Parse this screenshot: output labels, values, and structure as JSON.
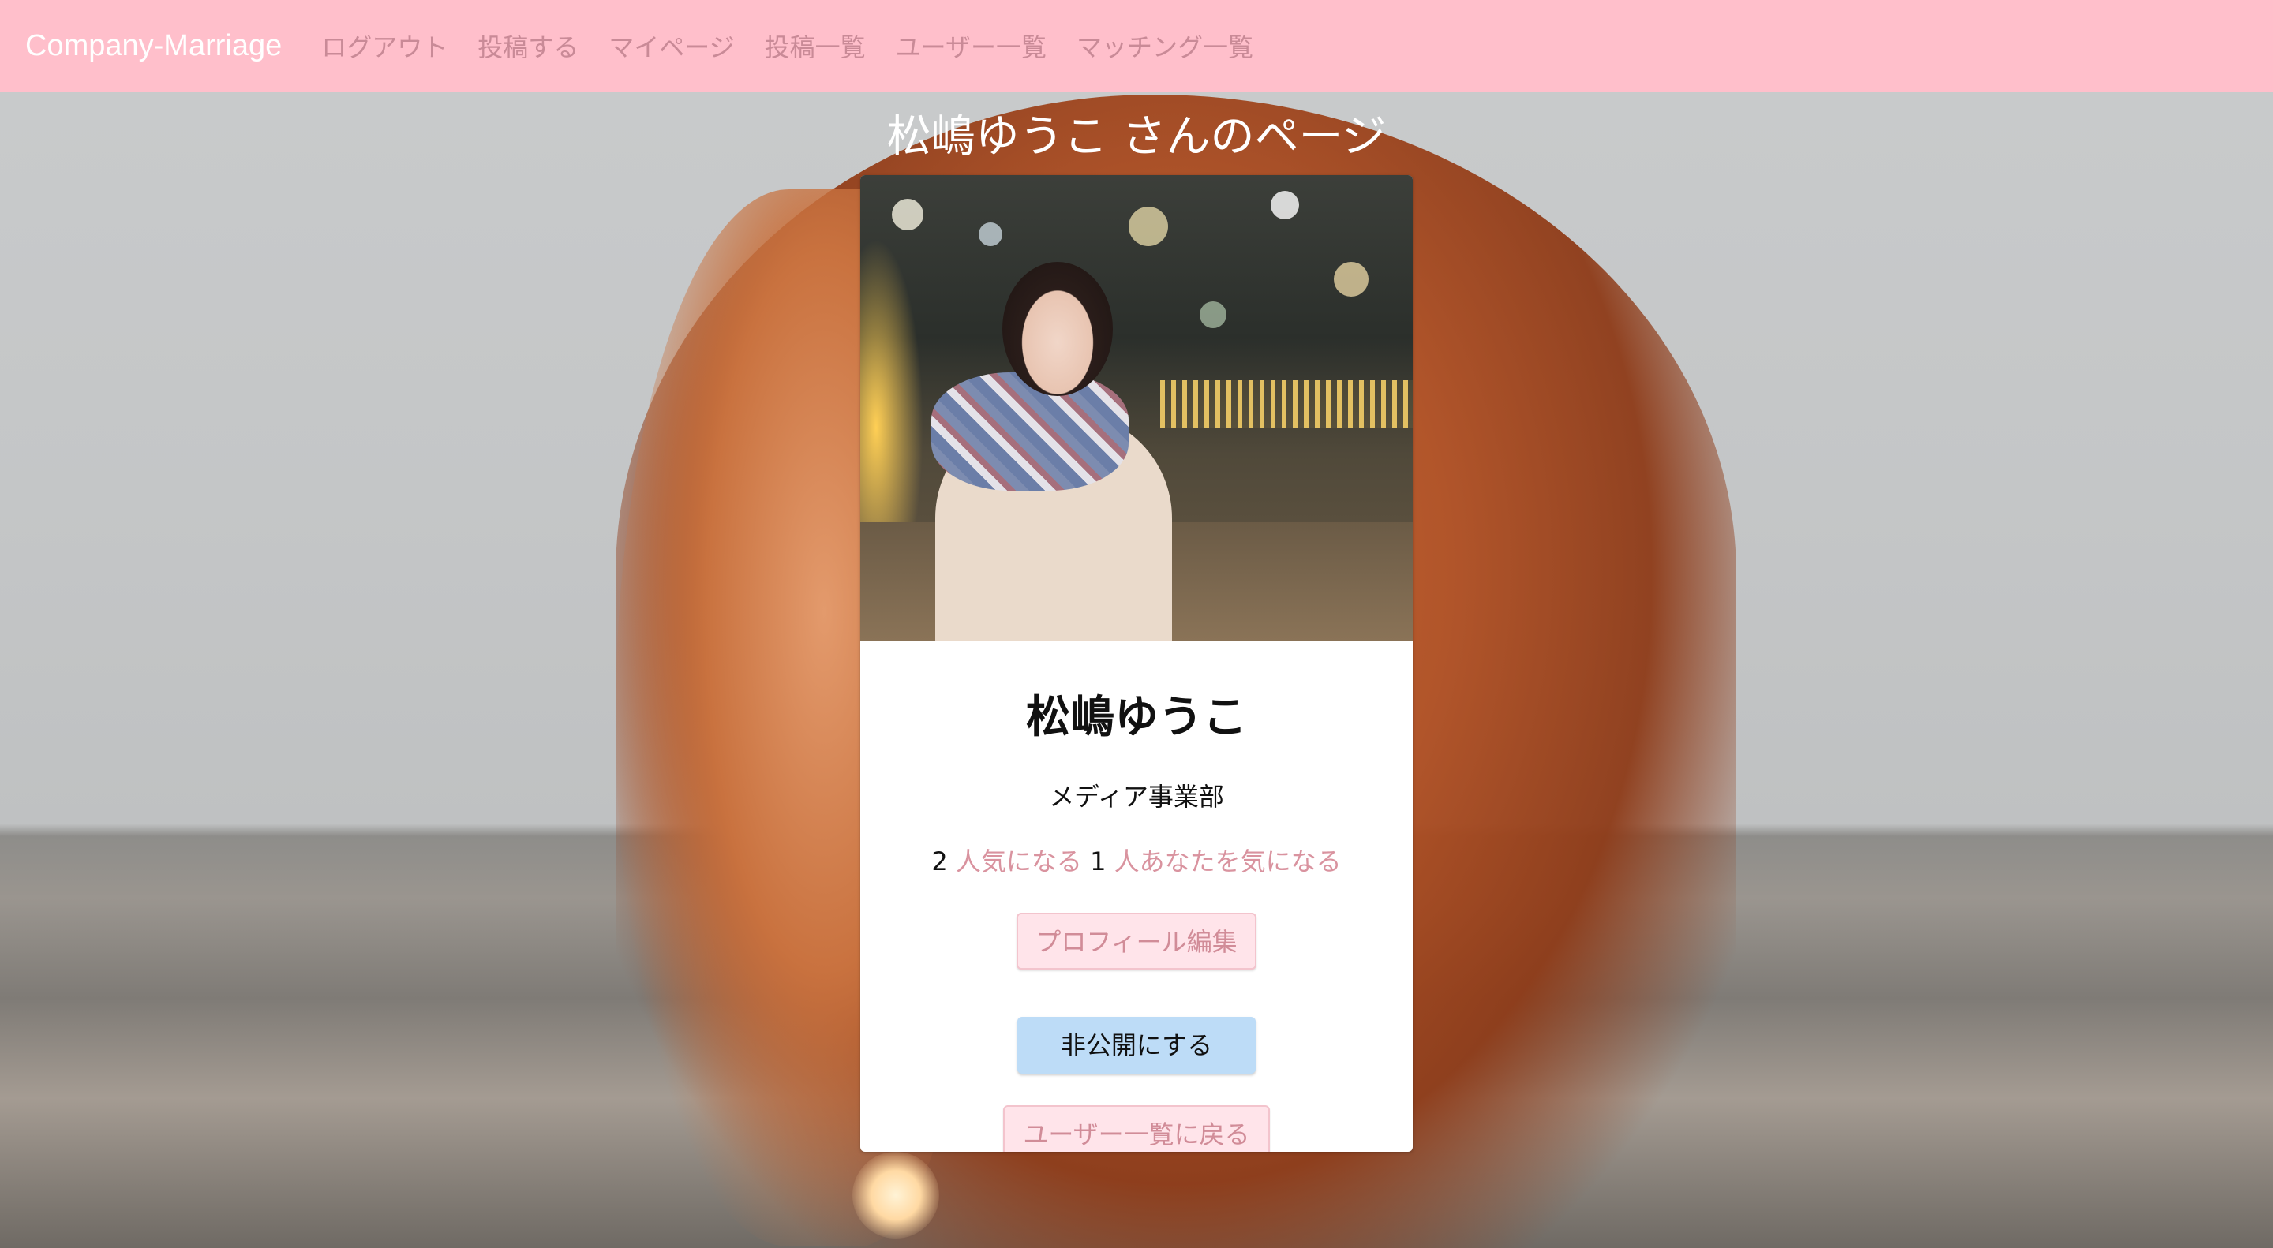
{
  "navbar": {
    "brand": "Company-Marriage",
    "links": [
      {
        "label": "ログアウト"
      },
      {
        "label": "投稿する"
      },
      {
        "label": "マイページ"
      },
      {
        "label": "投稿一覧"
      },
      {
        "label": "ユーザー一覧"
      },
      {
        "label": "マッチング一覧"
      }
    ]
  },
  "page_title": "松嶋ゆうこ さんのページ",
  "profile": {
    "name": "松嶋ゆうこ",
    "department": "メディア事業部",
    "following_count": "2",
    "following_label": "人気になる",
    "followers_count": "1",
    "followers_label": "人あなたを気になる",
    "edit_button": "プロフィール編集",
    "private_button": "非公開にする",
    "back_button": "ユーザー一覧に戻る"
  },
  "colors": {
    "navbar_bg": "#ffbfcb",
    "nav_link": "#c98a97",
    "accent_link": "#d9939f",
    "private_button_bg": "#bddcf7"
  }
}
